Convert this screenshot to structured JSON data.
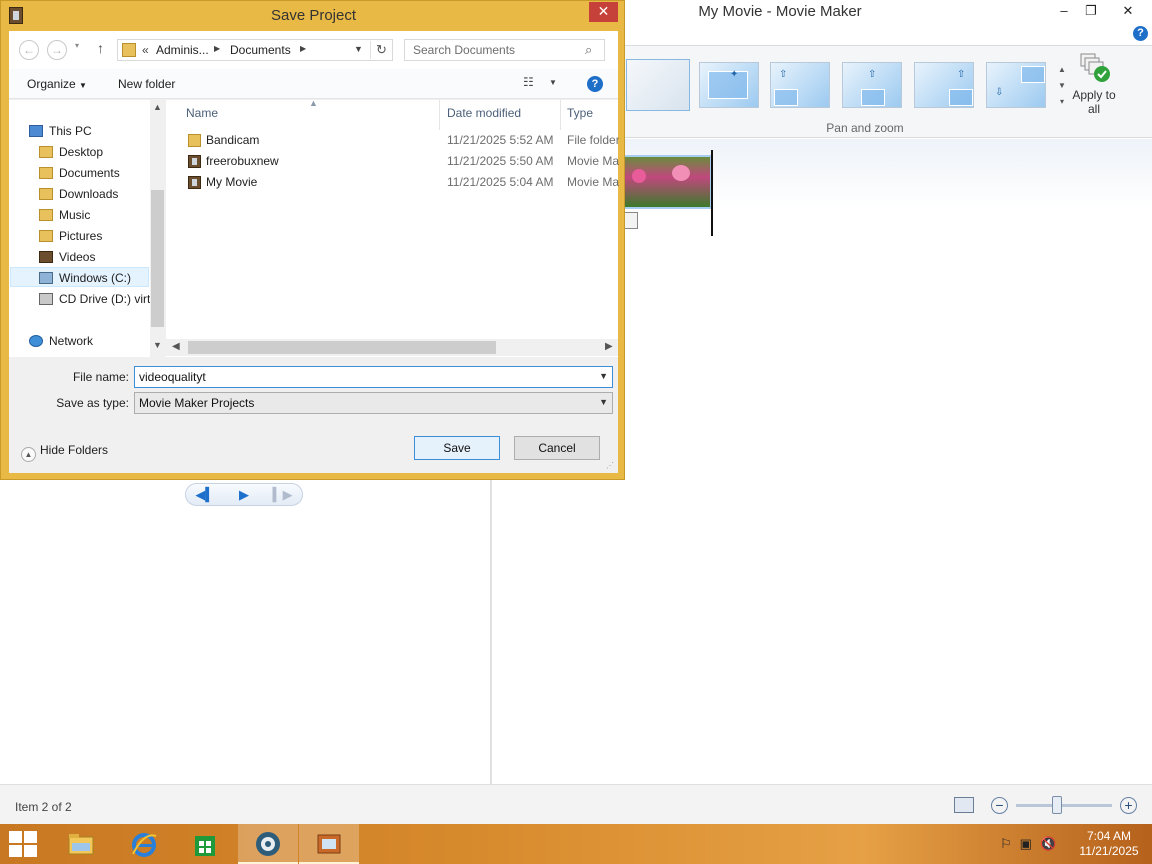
{
  "movie_maker": {
    "window_title": "My Movie - Movie Maker",
    "ribbon": {
      "pan_zoom_group_label": "Pan and zoom",
      "apply_to_all_label": "Apply to all"
    },
    "status_text": "Item 2 of 2"
  },
  "dialog": {
    "title": "Save Project",
    "close_glyph": "✕",
    "breadcrumb": {
      "overflow": "«",
      "items": [
        "Adminis...",
        "Documents"
      ]
    },
    "search_placeholder": "Search Documents",
    "toolbar": {
      "organize_label": "Organize",
      "new_folder_label": "New folder"
    },
    "nav_tree": [
      {
        "label": "This PC",
        "icon": "pc-icon"
      },
      {
        "label": "Desktop",
        "icon": "folder-icon"
      },
      {
        "label": "Documents",
        "icon": "folder-icon"
      },
      {
        "label": "Downloads",
        "icon": "folder-icon"
      },
      {
        "label": "Music",
        "icon": "folder-icon"
      },
      {
        "label": "Pictures",
        "icon": "folder-icon"
      },
      {
        "label": "Videos",
        "icon": "folder-icon"
      },
      {
        "label": "Windows (C:)",
        "icon": "drive-icon",
        "selected": true
      },
      {
        "label": "CD Drive (D:) virt",
        "icon": "cd-drive-icon"
      },
      {
        "label": "Network",
        "icon": "network-icon"
      }
    ],
    "columns": {
      "name": "Name",
      "date_modified": "Date modified",
      "type": "Type"
    },
    "files": [
      {
        "name": "Bandicam",
        "date": "11/21/2025 5:52 AM",
        "type": "File folder",
        "icon": "folder"
      },
      {
        "name": "freerobuxnew",
        "date": "11/21/2025 5:50 AM",
        "type": "Movie Maker Project",
        "icon": "film"
      },
      {
        "name": "My Movie",
        "date": "11/21/2025 5:04 AM",
        "type": "Movie Maker Project",
        "icon": "film"
      }
    ],
    "file_name_label": "File name:",
    "file_name_value": "videoqualityt",
    "save_as_type_label": "Save as type:",
    "save_as_type_value": "Movie Maker Projects",
    "hide_folders_label": "Hide Folders",
    "save_label": "Save",
    "cancel_label": "Cancel"
  },
  "taskbar": {
    "time": "7:04 AM",
    "date": "11/21/2025"
  },
  "colors": {
    "dialog_frame": "#e9b945",
    "taskbar": "#d78a2c",
    "accent_blue": "#3c8ed9"
  }
}
